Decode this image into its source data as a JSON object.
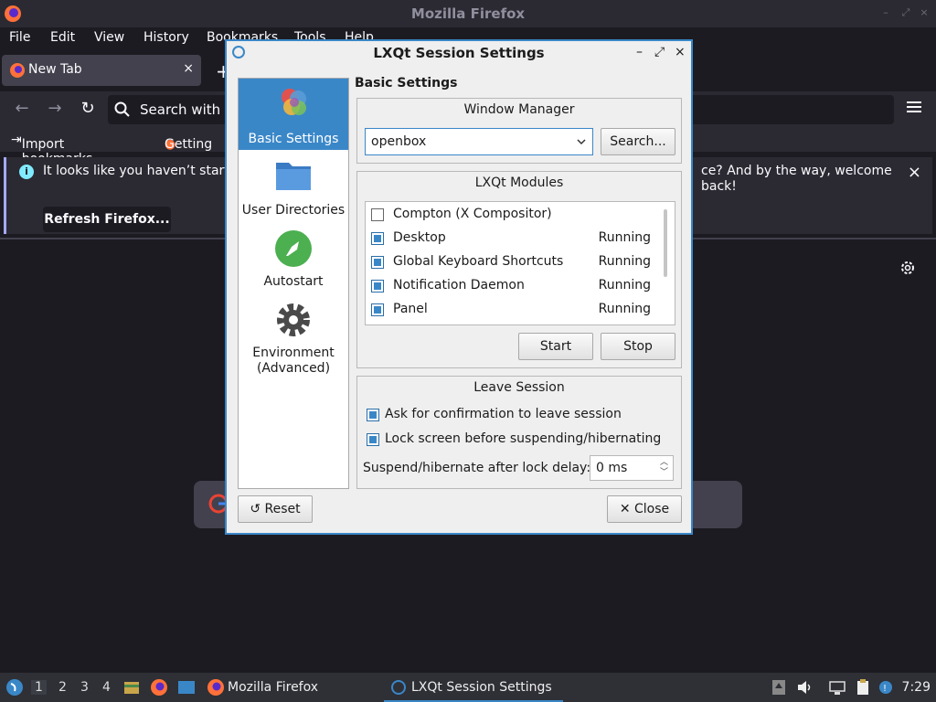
{
  "firefox": {
    "window_title": "Mozilla Firefox",
    "menu": [
      "File",
      "Edit",
      "View",
      "History",
      "Bookmarks",
      "Tools",
      "Help"
    ],
    "tab_label": "New Tab",
    "tab_close": "×",
    "new_tab": "+",
    "url_placeholder": "Search with G",
    "bookmarks": [
      "Import bookmarks...",
      "Getting"
    ],
    "notice_text": "It looks like you haven’t starte",
    "notice_text_cont": "ce? And by the way, welcome back!",
    "refresh_button": "Refresh Firefox...",
    "notice_close": "×"
  },
  "dialog": {
    "title": "LXQt Session Settings",
    "controls": {
      "minimize": "–",
      "maximize": "⤢",
      "close": "×"
    },
    "sidebar": [
      {
        "label": "Basic Settings",
        "icon": "lxqt-logo-icon",
        "active": true
      },
      {
        "label": "User Directories",
        "icon": "folder-icon",
        "active": false
      },
      {
        "label": "Autostart",
        "icon": "rocket-icon",
        "active": false
      },
      {
        "label": "Environment\n(Advanced)",
        "icon": "gear-icon",
        "active": false
      }
    ],
    "section_title": "Basic Settings",
    "window_manager": {
      "group_title": "Window Manager",
      "value": "openbox",
      "search_button": "Search..."
    },
    "modules": {
      "group_title": "LXQt Modules",
      "items": [
        {
          "name": "Compton (X Compositor)",
          "checked": false,
          "status": ""
        },
        {
          "name": "Desktop",
          "checked": true,
          "status": "Running"
        },
        {
          "name": "Global Keyboard Shortcuts",
          "checked": true,
          "status": "Running"
        },
        {
          "name": "Notification Daemon",
          "checked": true,
          "status": "Running"
        },
        {
          "name": "Panel",
          "checked": true,
          "status": "Running"
        }
      ],
      "start_button": "Start",
      "stop_button": "Stop"
    },
    "leave_session": {
      "group_title": "Leave Session",
      "confirm_label": "Ask for confirmation to leave session",
      "confirm_checked": true,
      "lock_label": "Lock screen before suspending/hibernating",
      "lock_checked": true,
      "delay_label": "Suspend/hibernate after lock delay:",
      "delay_value": "0 ms"
    },
    "reset_button": "Reset",
    "close_button": "Close"
  },
  "taskbar": {
    "workspaces": [
      "1",
      "2",
      "3",
      "4"
    ],
    "active_workspace": "1",
    "tasks": [
      {
        "label": "Mozilla Firefox",
        "icon": "firefox-icon",
        "active": false
      },
      {
        "label": "LXQt Session Settings",
        "icon": "lxqt-icon",
        "active": true
      }
    ],
    "clock": "7:29"
  },
  "colors": {
    "accent": "#3a87c8",
    "firefox_dark": "#1c1b22",
    "dialog_bg": "#efefef"
  }
}
